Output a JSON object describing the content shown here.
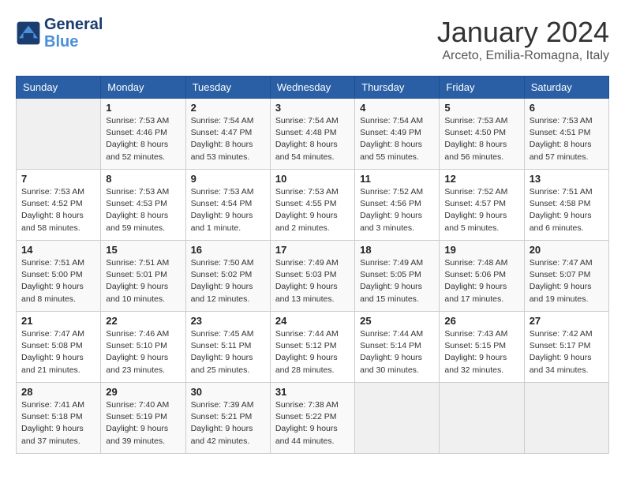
{
  "header": {
    "logo_line1": "General",
    "logo_line2": "Blue",
    "month": "January 2024",
    "location": "Arceto, Emilia-Romagna, Italy"
  },
  "weekdays": [
    "Sunday",
    "Monday",
    "Tuesday",
    "Wednesday",
    "Thursday",
    "Friday",
    "Saturday"
  ],
  "weeks": [
    [
      {
        "day": "",
        "info": ""
      },
      {
        "day": "1",
        "info": "Sunrise: 7:53 AM\nSunset: 4:46 PM\nDaylight: 8 hours\nand 52 minutes."
      },
      {
        "day": "2",
        "info": "Sunrise: 7:54 AM\nSunset: 4:47 PM\nDaylight: 8 hours\nand 53 minutes."
      },
      {
        "day": "3",
        "info": "Sunrise: 7:54 AM\nSunset: 4:48 PM\nDaylight: 8 hours\nand 54 minutes."
      },
      {
        "day": "4",
        "info": "Sunrise: 7:54 AM\nSunset: 4:49 PM\nDaylight: 8 hours\nand 55 minutes."
      },
      {
        "day": "5",
        "info": "Sunrise: 7:53 AM\nSunset: 4:50 PM\nDaylight: 8 hours\nand 56 minutes."
      },
      {
        "day": "6",
        "info": "Sunrise: 7:53 AM\nSunset: 4:51 PM\nDaylight: 8 hours\nand 57 minutes."
      }
    ],
    [
      {
        "day": "7",
        "info": "Sunrise: 7:53 AM\nSunset: 4:52 PM\nDaylight: 8 hours\nand 58 minutes."
      },
      {
        "day": "8",
        "info": "Sunrise: 7:53 AM\nSunset: 4:53 PM\nDaylight: 8 hours\nand 59 minutes."
      },
      {
        "day": "9",
        "info": "Sunrise: 7:53 AM\nSunset: 4:54 PM\nDaylight: 9 hours\nand 1 minute."
      },
      {
        "day": "10",
        "info": "Sunrise: 7:53 AM\nSunset: 4:55 PM\nDaylight: 9 hours\nand 2 minutes."
      },
      {
        "day": "11",
        "info": "Sunrise: 7:52 AM\nSunset: 4:56 PM\nDaylight: 9 hours\nand 3 minutes."
      },
      {
        "day": "12",
        "info": "Sunrise: 7:52 AM\nSunset: 4:57 PM\nDaylight: 9 hours\nand 5 minutes."
      },
      {
        "day": "13",
        "info": "Sunrise: 7:51 AM\nSunset: 4:58 PM\nDaylight: 9 hours\nand 6 minutes."
      }
    ],
    [
      {
        "day": "14",
        "info": "Sunrise: 7:51 AM\nSunset: 5:00 PM\nDaylight: 9 hours\nand 8 minutes."
      },
      {
        "day": "15",
        "info": "Sunrise: 7:51 AM\nSunset: 5:01 PM\nDaylight: 9 hours\nand 10 minutes."
      },
      {
        "day": "16",
        "info": "Sunrise: 7:50 AM\nSunset: 5:02 PM\nDaylight: 9 hours\nand 12 minutes."
      },
      {
        "day": "17",
        "info": "Sunrise: 7:49 AM\nSunset: 5:03 PM\nDaylight: 9 hours\nand 13 minutes."
      },
      {
        "day": "18",
        "info": "Sunrise: 7:49 AM\nSunset: 5:05 PM\nDaylight: 9 hours\nand 15 minutes."
      },
      {
        "day": "19",
        "info": "Sunrise: 7:48 AM\nSunset: 5:06 PM\nDaylight: 9 hours\nand 17 minutes."
      },
      {
        "day": "20",
        "info": "Sunrise: 7:47 AM\nSunset: 5:07 PM\nDaylight: 9 hours\nand 19 minutes."
      }
    ],
    [
      {
        "day": "21",
        "info": "Sunrise: 7:47 AM\nSunset: 5:08 PM\nDaylight: 9 hours\nand 21 minutes."
      },
      {
        "day": "22",
        "info": "Sunrise: 7:46 AM\nSunset: 5:10 PM\nDaylight: 9 hours\nand 23 minutes."
      },
      {
        "day": "23",
        "info": "Sunrise: 7:45 AM\nSunset: 5:11 PM\nDaylight: 9 hours\nand 25 minutes."
      },
      {
        "day": "24",
        "info": "Sunrise: 7:44 AM\nSunset: 5:12 PM\nDaylight: 9 hours\nand 28 minutes."
      },
      {
        "day": "25",
        "info": "Sunrise: 7:44 AM\nSunset: 5:14 PM\nDaylight: 9 hours\nand 30 minutes."
      },
      {
        "day": "26",
        "info": "Sunrise: 7:43 AM\nSunset: 5:15 PM\nDaylight: 9 hours\nand 32 minutes."
      },
      {
        "day": "27",
        "info": "Sunrise: 7:42 AM\nSunset: 5:17 PM\nDaylight: 9 hours\nand 34 minutes."
      }
    ],
    [
      {
        "day": "28",
        "info": "Sunrise: 7:41 AM\nSunset: 5:18 PM\nDaylight: 9 hours\nand 37 minutes."
      },
      {
        "day": "29",
        "info": "Sunrise: 7:40 AM\nSunset: 5:19 PM\nDaylight: 9 hours\nand 39 minutes."
      },
      {
        "day": "30",
        "info": "Sunrise: 7:39 AM\nSunset: 5:21 PM\nDaylight: 9 hours\nand 42 minutes."
      },
      {
        "day": "31",
        "info": "Sunrise: 7:38 AM\nSunset: 5:22 PM\nDaylight: 9 hours\nand 44 minutes."
      },
      {
        "day": "",
        "info": ""
      },
      {
        "day": "",
        "info": ""
      },
      {
        "day": "",
        "info": ""
      }
    ]
  ]
}
